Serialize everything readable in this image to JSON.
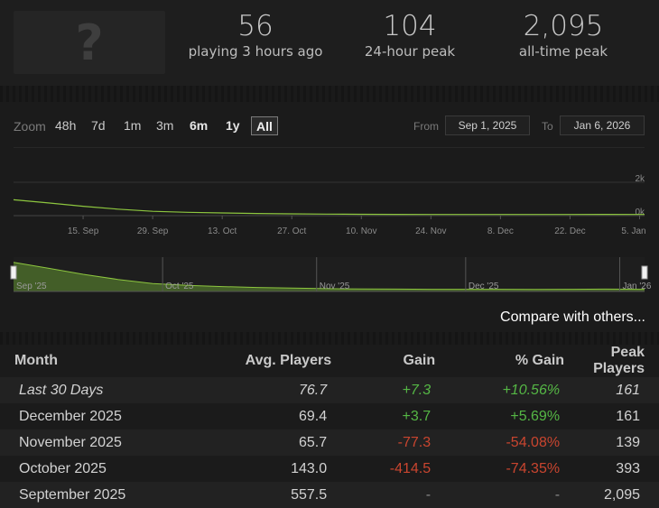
{
  "header": {
    "thumbnail_glyph": "?",
    "stats": [
      {
        "value": "56",
        "label": "playing 3 hours ago"
      },
      {
        "value": "104",
        "label": "24-hour peak"
      },
      {
        "value": "2,095",
        "label": "all-time peak"
      }
    ]
  },
  "zoom": {
    "label": "Zoom",
    "buttons": [
      "48h",
      "7d",
      "1m",
      "3m",
      "6m",
      "1y",
      "All"
    ],
    "active": "All",
    "from_label": "From",
    "from_value": "Sep 1, 2025",
    "to_label": "To",
    "to_value": "Jan 6, 2026"
  },
  "chart_data": {
    "type": "line",
    "y_tick_labels": [
      "2k",
      "0k"
    ],
    "x_tick_labels": [
      "15. Sep",
      "29. Sep",
      "13. Oct",
      "27. Oct",
      "10. Nov",
      "24. Nov",
      "8. Dec",
      "22. Dec",
      "5. Jan"
    ],
    "navigator_labels": [
      "Sep '25",
      "Oct '25",
      "Nov '25",
      "Dec '25",
      "Jan '26"
    ],
    "ylim": [
      0,
      2000
    ],
    "series": [
      {
        "x": [
          "2025-09-01",
          "2025-09-08",
          "2025-09-15",
          "2025-09-22",
          "2025-09-29",
          "2025-10-06",
          "2025-10-13",
          "2025-10-20",
          "2025-10-27",
          "2025-11-03",
          "2025-11-10",
          "2025-11-17",
          "2025-11-24",
          "2025-12-01",
          "2025-12-08",
          "2025-12-15",
          "2025-12-22",
          "2025-12-29",
          "2026-01-06"
        ],
        "values": [
          950,
          760,
          560,
          390,
          260,
          200,
          160,
          130,
          110,
          90,
          80,
          75,
          72,
          70,
          70,
          68,
          72,
          75,
          70
        ]
      }
    ],
    "color": "#8dc63f",
    "grid": true,
    "legend": "none"
  },
  "compare_link": "Compare with others...",
  "table": {
    "headers": [
      "Month",
      "Avg. Players",
      "Gain",
      "% Gain",
      "Peak Players"
    ],
    "rows": [
      {
        "month": "Last 30 Days",
        "avg": "76.7",
        "gain": "+7.3",
        "pct": "+10.56%",
        "peak": "161"
      },
      {
        "month": "December 2025",
        "avg": "69.4",
        "gain": "+3.7",
        "pct": "+5.69%",
        "peak": "161"
      },
      {
        "month": "November 2025",
        "avg": "65.7",
        "gain": "-77.3",
        "pct": "-54.08%",
        "peak": "139"
      },
      {
        "month": "October 2025",
        "avg": "143.0",
        "gain": "-414.5",
        "pct": "-74.35%",
        "peak": "393"
      },
      {
        "month": "September 2025",
        "avg": "557.5",
        "gain": "-",
        "pct": "-",
        "peak": "2,095"
      }
    ]
  },
  "colors": {
    "positive": "#55b745",
    "negative": "#c9452f",
    "line": "#8dc63f"
  }
}
